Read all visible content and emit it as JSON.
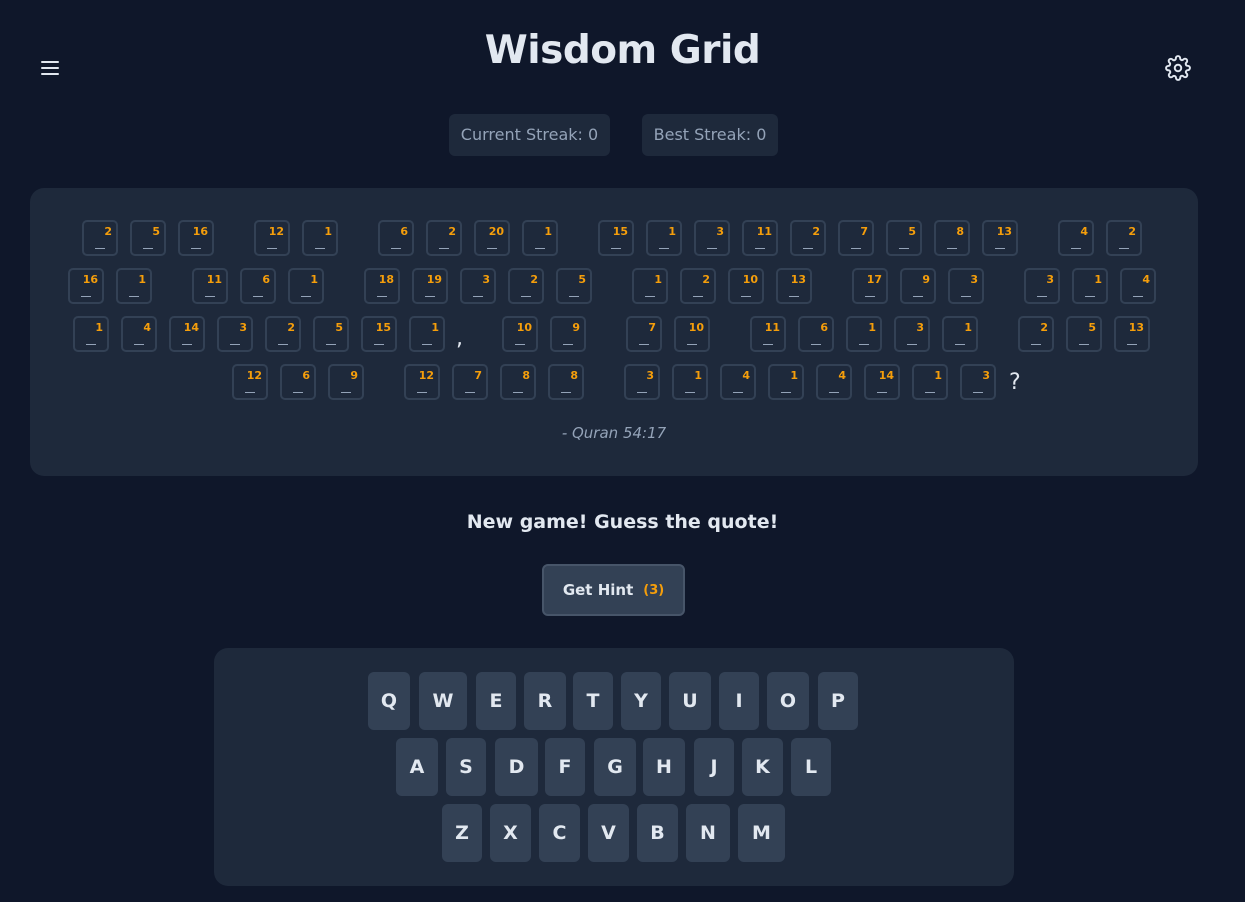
{
  "header": {
    "title": "Wisdom Grid"
  },
  "icons": {
    "menu": "menu-icon",
    "settings": "gear-icon"
  },
  "stats": {
    "current_streak": "Current Streak: 0",
    "best_streak": "Best Streak: 0"
  },
  "puzzle": {
    "rows": [
      [
        [
          "2",
          "5",
          "16"
        ],
        [
          "12",
          "1"
        ],
        [
          "6",
          "2",
          "20",
          "1"
        ],
        [
          "15",
          "1",
          "3",
          "11",
          "2",
          "7",
          "5",
          "8",
          "13"
        ],
        [
          "4",
          "2"
        ]
      ],
      [
        [
          "16",
          "1"
        ],
        [
          "11",
          "6",
          "1"
        ],
        [
          "18",
          "19",
          "3",
          "2",
          "5"
        ],
        [
          "1",
          "2",
          "10",
          "13"
        ],
        [
          "17",
          "9",
          "3"
        ],
        [
          "3",
          "1",
          "4"
        ]
      ],
      [
        [
          "1",
          "4",
          "14",
          "3",
          "2",
          "5",
          "15",
          "1"
        ],
        [
          "10",
          "9"
        ],
        [
          "7",
          "10"
        ],
        [
          "11",
          "6",
          "1",
          "3",
          "1"
        ],
        [
          "2",
          "5",
          "13"
        ]
      ],
      [
        [
          "12",
          "6",
          "9"
        ],
        [
          "12",
          "7",
          "8",
          "8"
        ],
        [
          "3",
          "1",
          "4",
          "1",
          "4",
          "14",
          "1",
          "3"
        ]
      ]
    ],
    "punctuation": [
      ",",
      "?"
    ],
    "source": "- Quran 54:17"
  },
  "message": "New game! Guess the quote!",
  "hint": {
    "label": "Get Hint",
    "count": "(3)"
  },
  "keyboard": {
    "rows": [
      [
        "Q",
        "W",
        "E",
        "R",
        "T",
        "Y",
        "U",
        "I",
        "O",
        "P"
      ],
      [
        "A",
        "S",
        "D",
        "F",
        "G",
        "H",
        "J",
        "K",
        "L"
      ],
      [
        "Z",
        "X",
        "C",
        "V",
        "B",
        "N",
        "M"
      ]
    ]
  },
  "colors": {
    "background": "#0f172a",
    "panel": "#1e293b",
    "key": "#334155",
    "accent": "#f59e0b",
    "text": "#e2e8f0"
  }
}
